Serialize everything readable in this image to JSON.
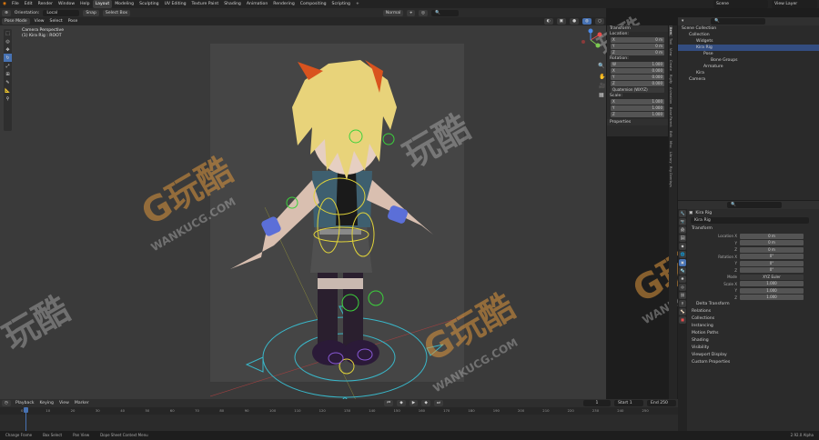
{
  "menu": [
    "File",
    "Edit",
    "Render",
    "Window",
    "Help"
  ],
  "workspaces": [
    "Layout",
    "Modeling",
    "Sculpting",
    "UV Editing",
    "Texture Paint",
    "Shading",
    "Animation",
    "Rendering",
    "Compositing",
    "Scripting"
  ],
  "scene": {
    "name": "Scene",
    "view_layer": "View Layer"
  },
  "header": {
    "orientation_label": "Orientation:",
    "orientation_value": "Local",
    "snap": "Snap",
    "select_box": "Select Box",
    "pivot": "Normal",
    "mode": "Pose Mode",
    "view": "View",
    "select": "Select",
    "pose": "Pose"
  },
  "viewport": {
    "camera_title": "Camera Perspective",
    "active_object": "(1) Kira Rig : ROOT"
  },
  "npanel": {
    "transform": "Transform",
    "location": "Location:",
    "loc": [
      {
        "a": "X",
        "v": "0 m"
      },
      {
        "a": "Y",
        "v": "0 m"
      },
      {
        "a": "Z",
        "v": "0 m"
      }
    ],
    "rotation": "Rotation:",
    "rot": [
      {
        "a": "W",
        "v": "1.000"
      },
      {
        "a": "X",
        "v": "0.000"
      },
      {
        "a": "Y",
        "v": "0.000"
      },
      {
        "a": "Z",
        "v": "0.000"
      }
    ],
    "rot_mode": "Quaternion (WXYZ)",
    "scale": "Scale:",
    "scl": [
      {
        "a": "X",
        "v": "1.000"
      },
      {
        "a": "Y",
        "v": "1.000"
      },
      {
        "a": "Z",
        "v": "1.000"
      }
    ],
    "properties": "Properties"
  },
  "side_tabs": [
    "Item",
    "Tool",
    "View",
    "Create",
    "Rigify",
    "Animation",
    "Bone Parent",
    "Edit",
    "Misc",
    "Library",
    "Rig Overlays"
  ],
  "outliner": {
    "rows": [
      "Scene Collection",
      "Collection",
      "Widgets",
      "Kira Rig",
      "Pose",
      "Bone Groups",
      "Armature",
      "Kira",
      "Camera"
    ]
  },
  "properties": {
    "object_name": "Kira Rig",
    "object_field": "Kira Rig",
    "transform": "Transform",
    "location_label": "Location X",
    "location": [
      "0 m",
      "0 m",
      "0 m"
    ],
    "rotation_label": "Rotation X",
    "rotation": [
      "0°",
      "0°",
      "0°"
    ],
    "mode_label": "Mode",
    "mode_value": "XYZ Euler",
    "scale_label": "Scale X",
    "scale": [
      "1.000",
      "1.000",
      "1.000"
    ],
    "y": "Y",
    "z": "Z",
    "delta": "Delta Transform",
    "sections": [
      "Relations",
      "Collections",
      "Instancing",
      "Motion Paths",
      "Shading",
      "Visibility",
      "Viewport Display",
      "Custom Properties"
    ]
  },
  "timeline": {
    "menus": [
      "Playback",
      "Keying",
      "View",
      "Marker"
    ],
    "current_frame": "1",
    "start_label": "Start",
    "start": "1",
    "end_label": "End",
    "end": "250",
    "ticks": [
      "0",
      "10",
      "20",
      "30",
      "40",
      "50",
      "60",
      "70",
      "80",
      "90",
      "100",
      "110",
      "120",
      "130",
      "140",
      "150",
      "160",
      "170",
      "180",
      "190",
      "200",
      "210",
      "220",
      "230",
      "240",
      "250"
    ]
  },
  "statusbar": {
    "items": [
      "Change Frame",
      "Box Select",
      "Pan View",
      "Dope Sheet Context Menu"
    ],
    "version": "2.92.0 Alpha"
  },
  "watermark": {
    "text": "玩酷",
    "url": "WANKUCG.COM",
    "letter": "G"
  },
  "colors": {
    "accent": "#4772b3",
    "selected": "#334d80",
    "hair": "#e8d37a",
    "horn": "#d9531e",
    "bone_green": "#3cd13c",
    "bone_yellow": "#e0d33a",
    "bone_cyan": "#39b7c9"
  }
}
